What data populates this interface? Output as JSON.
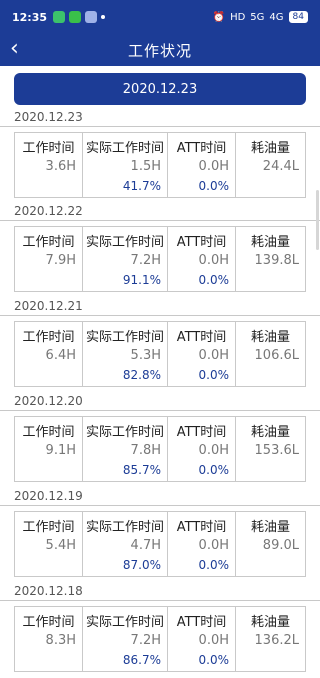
{
  "status": {
    "time": "12:35",
    "network": "HD",
    "signal1": "5G",
    "signal2": "4G",
    "battery": "84"
  },
  "nav": {
    "title": "工作状况"
  },
  "date_button": "2020.12.23",
  "labels": {
    "work": "工作时间",
    "actual": "实际工作时间",
    "att": "ATT时间",
    "fuel": "耗油量"
  },
  "records": [
    {
      "date": "2020.12.23",
      "work": "3.6H",
      "actual": "1.5H",
      "actual_pct": "41.7%",
      "att": "0.0H",
      "att_pct": "0.0%",
      "fuel": "24.4L"
    },
    {
      "date": "2020.12.22",
      "work": "7.9H",
      "actual": "7.2H",
      "actual_pct": "91.1%",
      "att": "0.0H",
      "att_pct": "0.0%",
      "fuel": "139.8L"
    },
    {
      "date": "2020.12.21",
      "work": "6.4H",
      "actual": "5.3H",
      "actual_pct": "82.8%",
      "att": "0.0H",
      "att_pct": "0.0%",
      "fuel": "106.6L"
    },
    {
      "date": "2020.12.20",
      "work": "9.1H",
      "actual": "7.8H",
      "actual_pct": "85.7%",
      "att": "0.0H",
      "att_pct": "0.0%",
      "fuel": "153.6L"
    },
    {
      "date": "2020.12.19",
      "work": "5.4H",
      "actual": "4.7H",
      "actual_pct": "87.0%",
      "att": "0.0H",
      "att_pct": "0.0%",
      "fuel": "89.0L"
    },
    {
      "date": "2020.12.18",
      "work": "8.3H",
      "actual": "7.2H",
      "actual_pct": "86.7%",
      "att": "0.0H",
      "att_pct": "0.0%",
      "fuel": "136.2L"
    }
  ]
}
